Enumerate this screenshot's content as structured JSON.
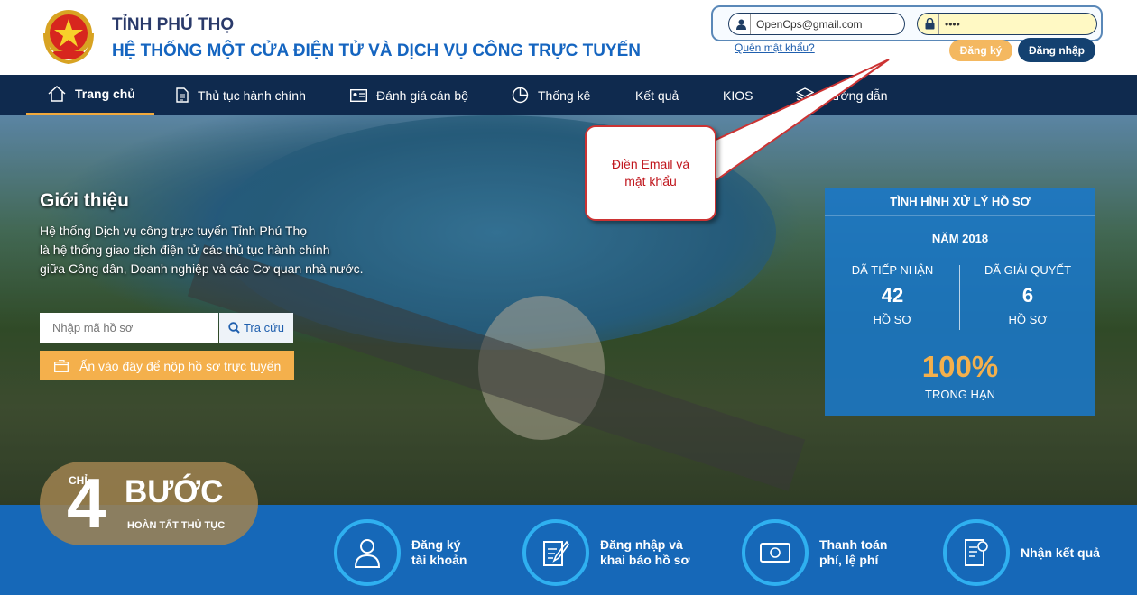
{
  "header": {
    "province": "TỈNH PHÚ THỌ",
    "system_name": "HỆ THỐNG MỘT CỬA ĐIỆN TỬ VÀ DỊCH VỤ CÔNG TRỰC TUYẾN",
    "email_value": "OpenCps@gmail.com",
    "password_value": "••••",
    "forgot_password": "Quên mật khẩu?",
    "register_label": "Đăng ký",
    "login_label": "Đăng nhập"
  },
  "nav": {
    "items": [
      {
        "label": "Trang chủ"
      },
      {
        "label": "Thủ tục hành chính"
      },
      {
        "label": "Đánh giá cán bộ"
      },
      {
        "label": "Thống kê"
      },
      {
        "label": "Kết quả"
      },
      {
        "label": "KIOS"
      },
      {
        "label": "Hướng dẫn"
      }
    ]
  },
  "intro": {
    "title": "Giới thiệu",
    "lines": [
      "Hệ thống Dịch vụ công trực tuyến Tỉnh Phú Thọ",
      "là hệ thống giao dịch điện tử các thủ tục hành chính",
      "giữa Công dân, Doanh nghiệp và các Cơ quan nhà nước."
    ],
    "search_placeholder": "Nhập mã hồ sơ",
    "search_button": "Tra cứu",
    "submit_button": "Ấn vào đây để nộp hồ sơ trực tuyến"
  },
  "callout": {
    "text": "Điền Email và mật khẩu"
  },
  "stats": {
    "heading": "TÌNH HÌNH XỬ LÝ HỒ SƠ",
    "year": "NĂM 2018",
    "received_label": "ĐÃ TIẾP NHẬN",
    "received_value": "42",
    "received_unit": "HỒ SƠ",
    "resolved_label": "ĐÃ GIẢI QUYẾT",
    "resolved_value": "6",
    "resolved_unit": "HỒ SƠ",
    "on_time_pct": "100%",
    "on_time_label": "TRONG HẠN"
  },
  "steps": {
    "badge_prefix": "CHỈ",
    "badge_number": "4",
    "badge_word": "BƯỚC",
    "badge_sub": "HOÀN TẤT THỦ TỤC",
    "items": [
      {
        "line1": "Đăng ký",
        "line2": "tài khoản",
        "icon": "user-icon"
      },
      {
        "line1": "Đăng nhập và",
        "line2": "khai báo hồ sơ",
        "icon": "edit-form-icon"
      },
      {
        "line1": "Thanh toán",
        "line2": "phí, lệ phí",
        "icon": "money-icon"
      },
      {
        "line1": "Nhận kết quả",
        "line2": "",
        "icon": "certificate-icon"
      }
    ]
  },
  "colors": {
    "nav_bg": "#0f2a4e",
    "accent_orange": "#f4b04c",
    "brand_blue": "#1565c0",
    "steps_bg": "#1668b8"
  }
}
